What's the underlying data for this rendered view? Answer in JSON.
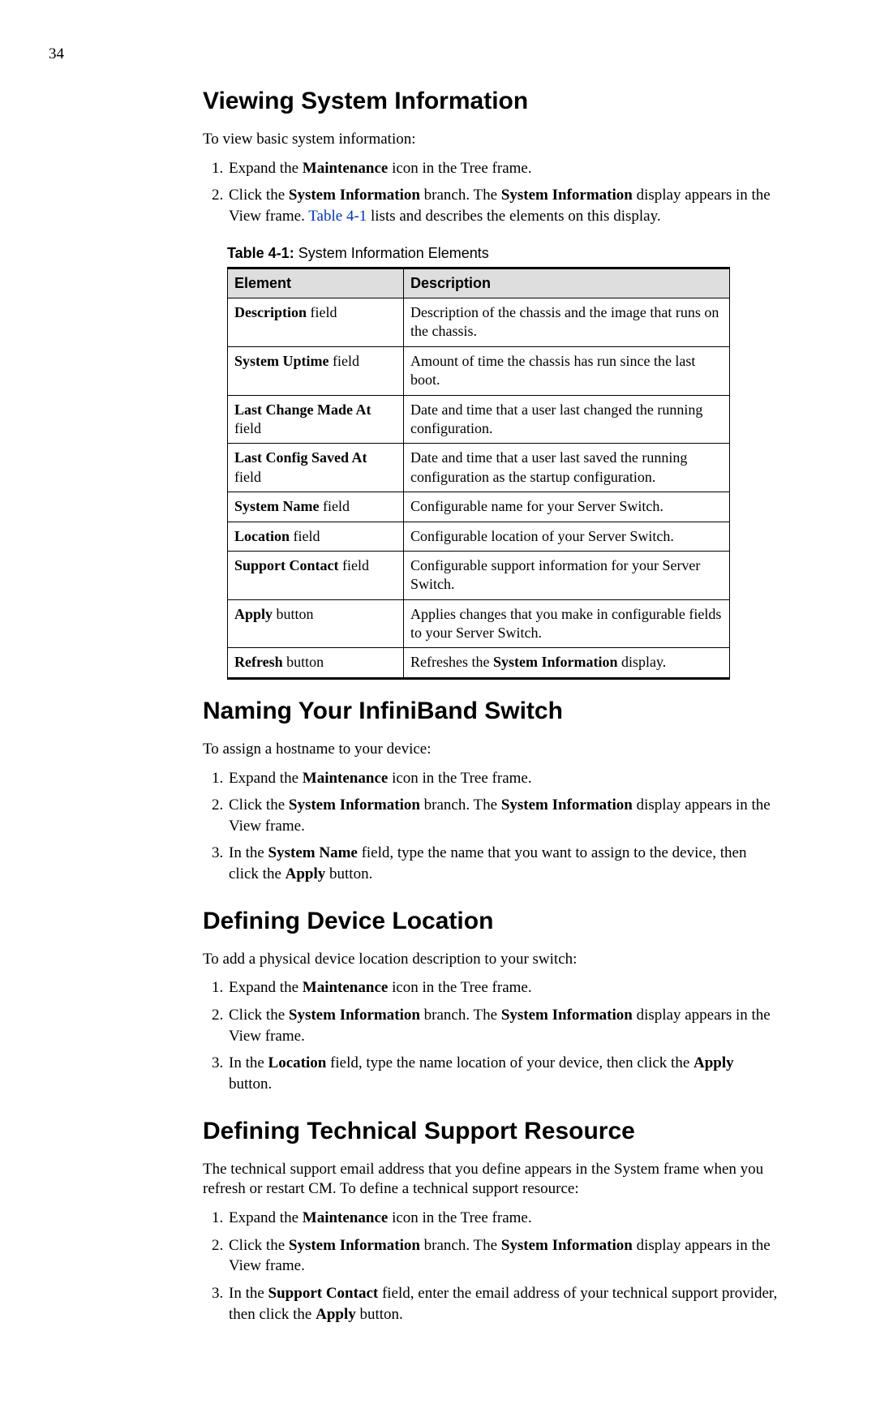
{
  "page_number": "34",
  "sections": {
    "s1": {
      "heading": "Viewing System Information",
      "intro": "To view basic system information:",
      "steps": {
        "0": {
          "pre": "Expand the ",
          "b1": "Maintenance",
          "post": " icon in the Tree frame."
        },
        "1": {
          "pre": "Click the ",
          "b1": "System Information",
          "mid1": " branch. The ",
          "b2": "System Information",
          "mid2": " display appears in the View frame. ",
          "xref": "Table 4-1",
          "post": " lists and describes the elements on this display."
        }
      }
    },
    "table": {
      "caption_label": "Table 4-1:",
      "caption_text": " System Information Elements",
      "head": {
        "c0": "Element",
        "c1": "Description"
      },
      "rows": {
        "0": {
          "elname": "Description",
          "eltype": " field",
          "desc_pre": "Description of the chassis and the image that runs on the chassis."
        },
        "1": {
          "elname": "System Uptime",
          "eltype": " field",
          "desc_pre": "Amount of time the chassis has run since the last boot."
        },
        "2": {
          "elname": "Last Change Made At",
          "eltype": " field",
          "desc_pre": "Date and time that a user last changed the running configuration."
        },
        "3": {
          "elname": "Last Config Saved At",
          "eltype": " field",
          "desc_pre": "Date and time that a user last saved the running configuration as the startup configuration."
        },
        "4": {
          "elname": "System Name",
          "eltype": " field",
          "desc_pre": "Configurable name for your Server Switch."
        },
        "5": {
          "elname": "Location",
          "eltype": " field",
          "desc_pre": "Configurable location of your Server Switch."
        },
        "6": {
          "elname": "Support Contact",
          "eltype": " field",
          "desc_pre": "Configurable support information for your Server Switch."
        },
        "7": {
          "elname": "Apply",
          "eltype": " button",
          "desc_pre": "Applies changes that you make in configurable fields to your Server Switch."
        },
        "8": {
          "elname": "Refresh",
          "eltype": " button",
          "desc_pre": "Refreshes the ",
          "desc_bold": "System Information",
          "desc_post": " display."
        }
      }
    },
    "s2": {
      "heading": "Naming Your InfiniBand Switch",
      "intro": "To assign a hostname to your device:",
      "steps": {
        "0": {
          "pre": "Expand the ",
          "b1": "Maintenance",
          "post": " icon in the Tree frame."
        },
        "1": {
          "pre": "Click the ",
          "b1": "System Information",
          "mid1": " branch. The ",
          "b2": "System Information",
          "post": " display appears in the View frame."
        },
        "2": {
          "pre": "In the ",
          "b1": "System Name",
          "mid1": " field, type the name that you want to assign to the device, then click the ",
          "b2": "Apply",
          "post": " button."
        }
      }
    },
    "s3": {
      "heading": "Defining Device Location",
      "intro": "To add a physical device location description to your switch:",
      "steps": {
        "0": {
          "pre": "Expand the ",
          "b1": "Maintenance",
          "post": " icon in the Tree frame."
        },
        "1": {
          "pre": "Click the ",
          "b1": "System Information",
          "mid1": " branch. The ",
          "b2": "System Information",
          "post": " display appears in the View frame."
        },
        "2": {
          "pre": "In the ",
          "b1": "Location",
          "mid1": " field, type the name location of your device, then click the ",
          "b2": "Apply",
          "post": " button."
        }
      }
    },
    "s4": {
      "heading": "Defining Technical Support Resource",
      "intro": "The technical support email address that you define appears in the System frame when you refresh or restart CM. To define a technical support resource:",
      "steps": {
        "0": {
          "pre": "Expand the ",
          "b1": "Maintenance",
          "post": " icon in the Tree frame."
        },
        "1": {
          "pre": "Click the ",
          "b1": "System Information",
          "mid1": " branch. The ",
          "b2": "System Information",
          "post": " display appears in the View frame."
        },
        "2": {
          "pre": "In the ",
          "b1": "Support Contact",
          "mid1": " field, enter the email address of your technical support provider, then click the ",
          "b2": "Apply",
          "post": " button."
        }
      }
    }
  }
}
